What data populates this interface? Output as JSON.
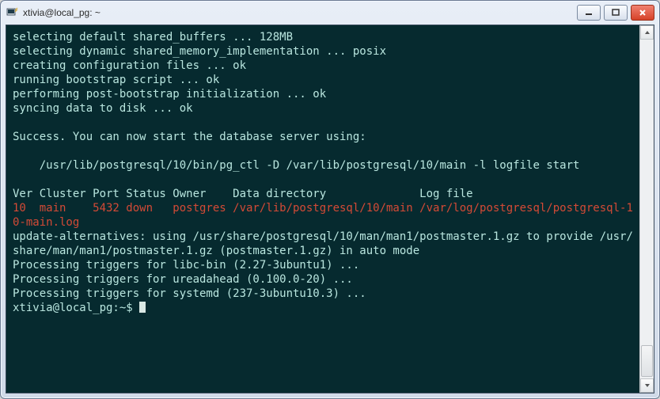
{
  "window": {
    "title": "xtivia@local_pg: ~"
  },
  "terminal": {
    "lines": [
      {
        "t": "selecting default shared_buffers ... 128MB"
      },
      {
        "t": "selecting dynamic shared_memory_implementation ... posix"
      },
      {
        "t": "creating configuration files ... ok"
      },
      {
        "t": "running bootstrap script ... ok"
      },
      {
        "t": "performing post-bootstrap initialization ... ok"
      },
      {
        "t": "syncing data to disk ... ok"
      },
      {
        "t": ""
      },
      {
        "t": "Success. You can now start the database server using:"
      },
      {
        "t": ""
      },
      {
        "t": "    /usr/lib/postgresql/10/bin/pg_ctl -D /var/lib/postgresql/10/main -l logfile start"
      },
      {
        "t": ""
      },
      {
        "t": "Ver Cluster Port Status Owner    Data directory              Log file"
      },
      {
        "t": "10  main    5432 down   postgres /var/lib/postgresql/10/main /var/log/postgresql/postgresql-10-main.log",
        "cls": "red"
      },
      {
        "t": "update-alternatives: using /usr/share/postgresql/10/man/man1/postmaster.1.gz to provide /usr/share/man/man1/postmaster.1.gz (postmaster.1.gz) in auto mode"
      },
      {
        "t": "Processing triggers for libc-bin (2.27-3ubuntu1) ..."
      },
      {
        "t": "Processing triggers for ureadahead (0.100.0-20) ..."
      },
      {
        "t": "Processing triggers for systemd (237-3ubuntu10.3) ..."
      }
    ],
    "prompt": "xtivia@local_pg:~$ "
  }
}
